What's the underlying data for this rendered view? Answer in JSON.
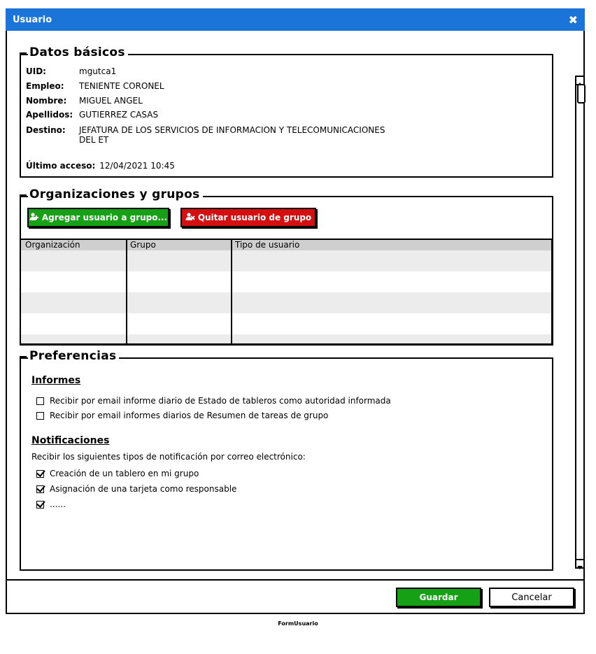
{
  "window": {
    "title": "Usuario",
    "close_icon": "close-icon"
  },
  "datos": {
    "legend": "Datos básicos",
    "fields": [
      {
        "label": "UID:",
        "value": "mgutca1"
      },
      {
        "label": "Empleo:",
        "value": "TENIENTE CORONEL"
      },
      {
        "label": "Nombre:",
        "value": "MIGUEL ANGEL"
      },
      {
        "label": "Apellidos:",
        "value": "GUTIERREZ CASAS"
      },
      {
        "label": "Destino:",
        "value": "JEFATURA DE LOS SERVICIOS DE INFORMACION Y TELECOMUNICACIONES",
        "value2": "DEL ET"
      }
    ],
    "ultimo_acceso_label": "Último acceso:",
    "ultimo_acceso_value": "12/04/2021 10:45"
  },
  "organizaciones": {
    "legend": "Organizaciones y grupos",
    "add_button": "Agregar usuario a grupo...",
    "remove_button": "Quitar usuario de grupo",
    "columns": [
      "Organización",
      "Grupo",
      "Tipo de usuario"
    ]
  },
  "preferencias": {
    "legend": "Preferencias",
    "informes_title": "Informes",
    "informes": [
      {
        "label": "Recibir por email informe diario de Estado de tableros como autoridad informada",
        "checked": false
      },
      {
        "label": "Recibir por email informes diarios de Resumen de tareas de grupo",
        "checked": false
      }
    ],
    "notificaciones_title": "Notificaciones",
    "notificaciones_intro": "Recibir los siguientes tipos de notificación por correo electrónico:",
    "notificaciones": [
      {
        "label": "Creación de un tablero en mi grupo",
        "checked": true
      },
      {
        "label": "Asignación de una tarjeta como responsable",
        "checked": true
      },
      {
        "label": "......",
        "checked": true
      }
    ]
  },
  "footer": {
    "save": "Guardar",
    "cancel": "Cancelar",
    "caption": "FormUsuario"
  },
  "colors": {
    "titlebar": "#1b74d8",
    "green": "#16a016",
    "red": "#d40f0f",
    "table_header": "#cfcfcf",
    "row_alt": "#ececec"
  }
}
